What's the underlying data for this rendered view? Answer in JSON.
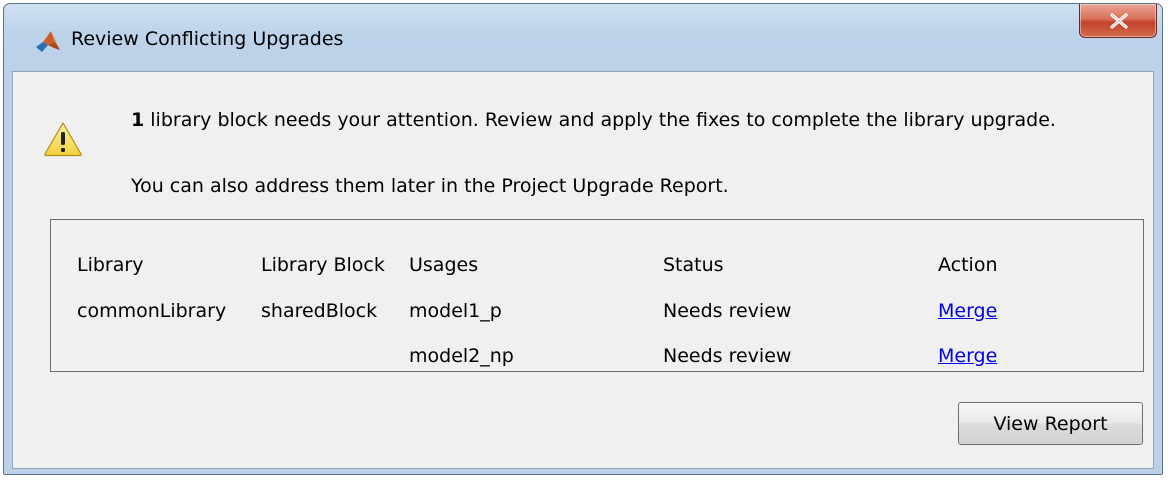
{
  "window": {
    "title": "Review Conflicting Upgrades",
    "app_icon": "matlab-icon",
    "close_icon": "close-icon"
  },
  "message": {
    "icon": "warning-icon",
    "count": "1",
    "line1_rest": " library block needs your attention. Review and apply the fixes to complete the library upgrade.",
    "line2": "You can also address them later in the Project Upgrade Report."
  },
  "table": {
    "headers": {
      "library": "Library",
      "library_block": "Library Block",
      "usages": "Usages",
      "status": "Status",
      "action": "Action"
    },
    "rows": [
      {
        "library": "commonLibrary",
        "library_block": "sharedBlock",
        "usage": "model1_p",
        "status": "Needs review",
        "action": "Merge"
      },
      {
        "library": "",
        "library_block": "",
        "usage": "model2_np",
        "status": "Needs review",
        "action": "Merge"
      }
    ]
  },
  "buttons": {
    "view_report": "View Report"
  },
  "colors": {
    "title_bar": "#bcd1e8",
    "client_background": "#f0f0f0",
    "close_button": "#c4432a",
    "link": "#0000ee",
    "warning_fill": "#f6d94e"
  }
}
